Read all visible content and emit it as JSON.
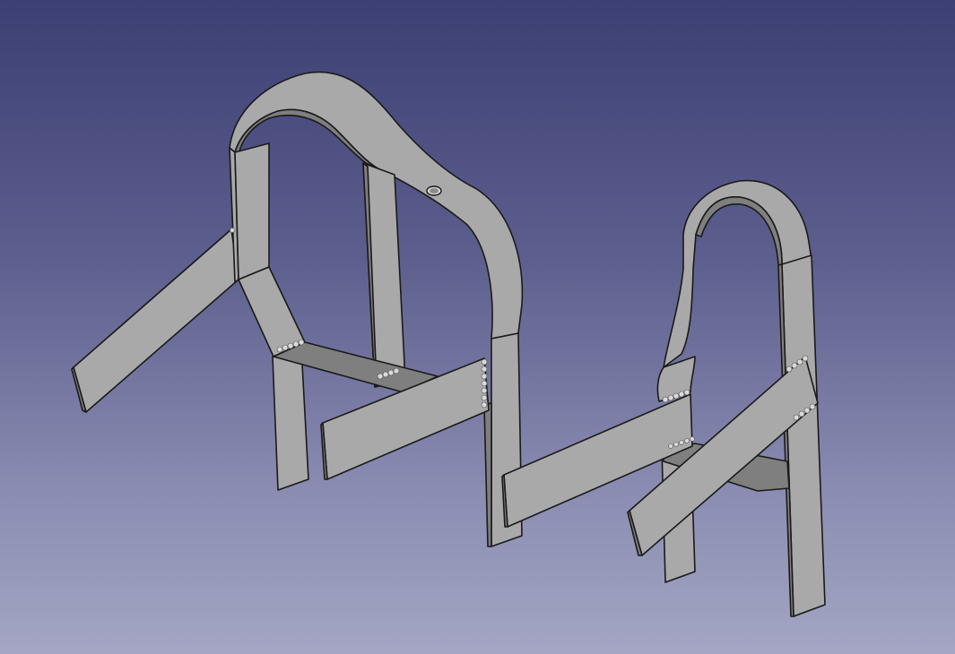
{
  "viewport": {
    "background_top": "#3c3f73",
    "background_bottom": "#a4a6c4",
    "part_color": "#a9a9a9",
    "edge_color": "#1a1a1a"
  },
  "model": {
    "frames": [
      "left-frame",
      "right-frame"
    ],
    "features": [
      "mounting-hole",
      "weld-beads"
    ]
  }
}
